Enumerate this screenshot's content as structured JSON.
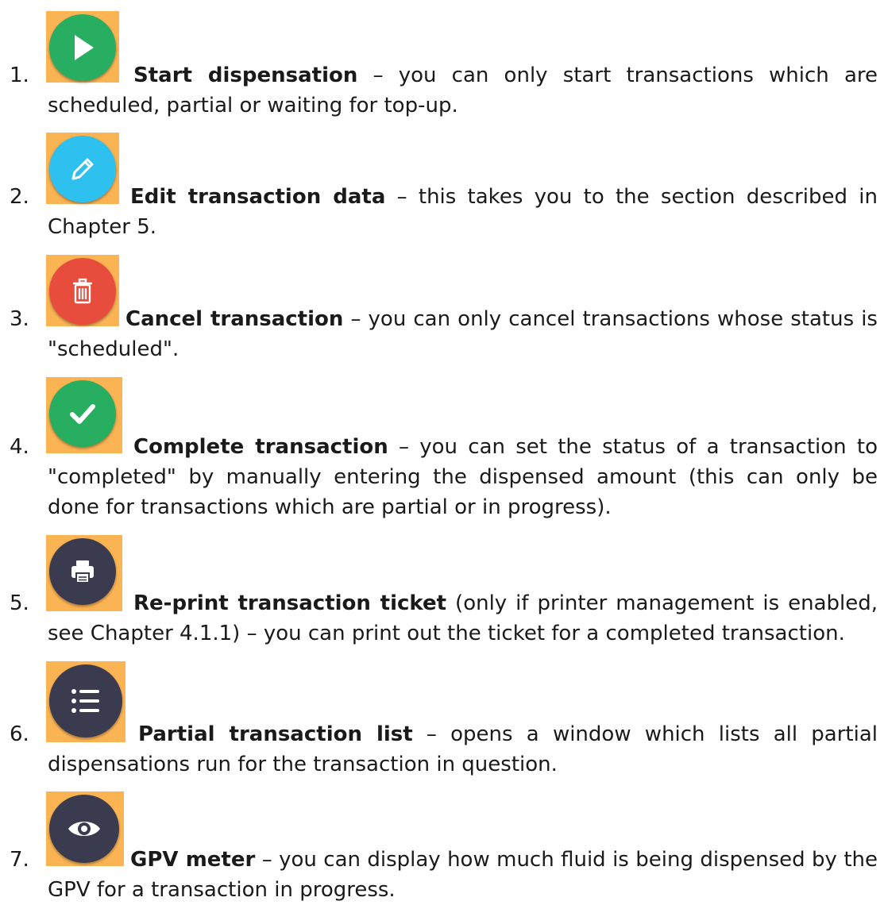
{
  "items": [
    {
      "number": "1.",
      "title": "Start dispensation",
      "line1_rest": " – you can only start transactions which are",
      "rest": "scheduled, partial or waiting for top-up.",
      "icon": "play-icon",
      "color": "#27ae60"
    },
    {
      "number": "2.",
      "title": "Edit transaction data",
      "line1_rest": " – this takes you to the section described in",
      "rest": "Chapter 5.",
      "icon": "pencil-icon",
      "color": "#2ec1f0"
    },
    {
      "number": "3.",
      "title": "Cancel transaction",
      "line1_rest": " – you can only cancel transactions whose status is",
      "rest": "\"scheduled\".",
      "icon": "trash-icon",
      "color": "#e84c3d"
    },
    {
      "number": "4.",
      "title": "Complete transaction",
      "line1_rest": " – you can set the status of a transaction to",
      "rest": "\"completed\" by manually entering the dispensed amount (this can only be done for transactions which are partial or in progress).",
      "icon": "check-icon",
      "color": "#27ae60"
    },
    {
      "number": "5.",
      "title": "Re-print transaction ticket",
      "line1_rest": " (only if printer management is enabled,",
      "rest": "see Chapter 4.1.1) – you can print out the ticket for a completed transaction.",
      "icon": "printer-icon",
      "color": "#3a3b4e"
    },
    {
      "number": "6.",
      "title": "Partial transaction list",
      "line1_rest": " – opens a window which lists all partial",
      "rest": "dispensations run for the transaction in question.",
      "icon": "list-icon",
      "color": "#3a3b4e"
    },
    {
      "number": "7.",
      "title": "GPV meter",
      "line1_rest": " – you can display how much fluid is being dispensed by the",
      "rest": "GPV for a transaction in progress.",
      "icon": "eye-icon",
      "color": "#3a3b4e"
    }
  ]
}
